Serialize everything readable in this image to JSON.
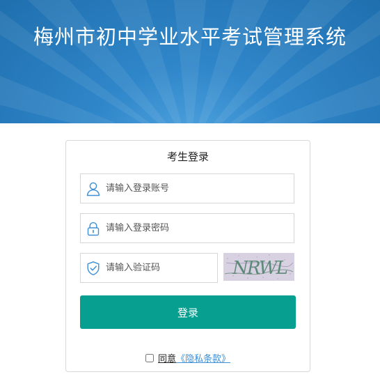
{
  "banner": {
    "title": "梅州市初中学业水平考试管理系统"
  },
  "login": {
    "title": "考生登录",
    "account_placeholder": "请输入登录账号",
    "password_placeholder": "请输入登录密码",
    "captcha_placeholder": "请输入验证码",
    "captcha_text": "NRWL",
    "button_label": "登录",
    "agree_label": "同意",
    "privacy_link": "《隐私条款》"
  },
  "icons": {
    "account": "user-icon",
    "password": "lock-icon",
    "captcha": "shield-check-icon"
  },
  "colors": {
    "banner": "#2f86c9",
    "primary_button": "#07a090",
    "icon": "#3d8fd6",
    "link": "#3d8fd6"
  }
}
